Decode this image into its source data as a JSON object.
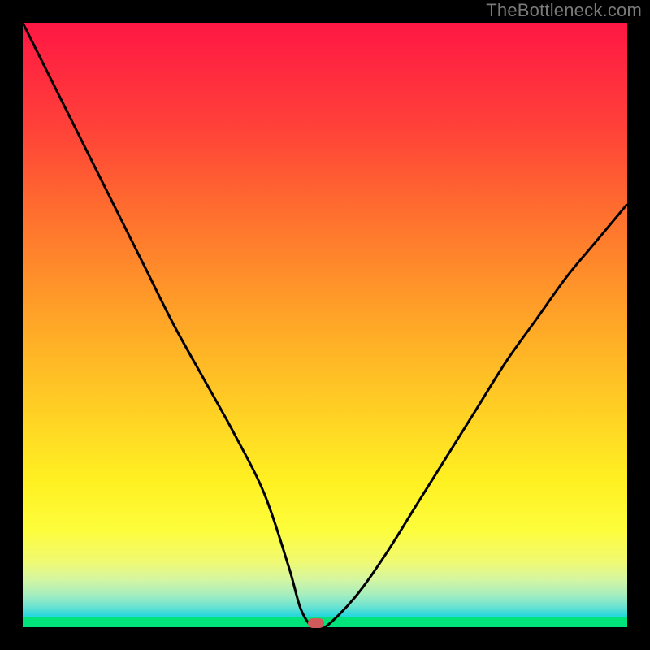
{
  "watermark": "TheBottleneck.com",
  "colors": {
    "frame": "#000000",
    "watermark": "#7a7a7a",
    "curve": "#000000",
    "marker": "#d15a5a",
    "green_band": "#00e27a"
  },
  "chart_data": {
    "type": "line",
    "title": "",
    "xlabel": "",
    "ylabel": "",
    "xlim": [
      0,
      100
    ],
    "ylim": [
      0,
      100
    ],
    "grid": false,
    "legend": false,
    "series": [
      {
        "name": "bottleneck-curve",
        "x": [
          0,
          5,
          10,
          15,
          20,
          25,
          30,
          35,
          40,
          44,
          46,
          48,
          50,
          55,
          60,
          65,
          70,
          75,
          80,
          85,
          90,
          95,
          100
        ],
        "values": [
          100,
          90,
          80,
          70,
          60,
          50,
          41,
          32,
          22,
          10,
          3,
          0,
          0,
          5,
          12,
          20,
          28,
          36,
          44,
          51,
          58,
          64,
          70
        ]
      }
    ],
    "annotations": [
      {
        "name": "optimum-marker",
        "x": 48.5,
        "y": 0
      }
    ],
    "background_gradient": {
      "orientation": "vertical",
      "stops": [
        {
          "pos": 0,
          "color": "#ff1744"
        },
        {
          "pos": 0.3,
          "color": "#ff6a2f"
        },
        {
          "pos": 0.66,
          "color": "#ffd524"
        },
        {
          "pos": 0.84,
          "color": "#fdfd3c"
        },
        {
          "pos": 0.98,
          "color": "#2bd8db"
        },
        {
          "pos": 1.0,
          "color": "#00d0e0"
        }
      ]
    }
  }
}
